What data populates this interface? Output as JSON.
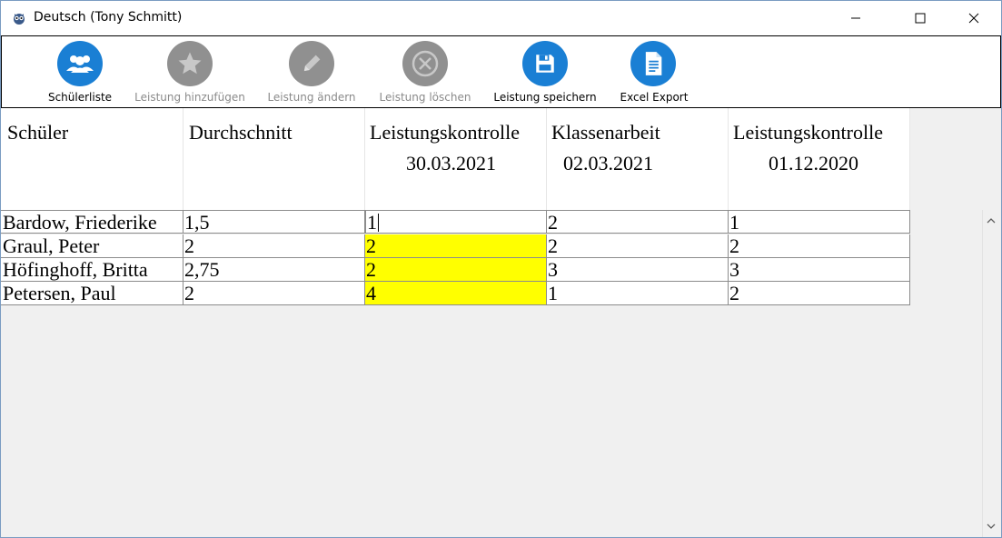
{
  "window": {
    "title": "Deutsch (Tony Schmitt)"
  },
  "toolbar": {
    "items": [
      {
        "label": "Schülerliste",
        "icon": "people-icon",
        "enabled": true
      },
      {
        "label": "Leistung hinzufügen",
        "icon": "star-icon",
        "enabled": false
      },
      {
        "label": "Leistung ändern",
        "icon": "pencil-icon",
        "enabled": false
      },
      {
        "label": "Leistung löschen",
        "icon": "delete-circle-icon",
        "enabled": false
      },
      {
        "label": "Leistung speichern",
        "icon": "floppy-disk-icon",
        "enabled": true
      },
      {
        "label": "Excel Export",
        "icon": "document-icon",
        "enabled": true
      }
    ]
  },
  "grid": {
    "headers": [
      {
        "line1": "Schüler",
        "line2": ""
      },
      {
        "line1": "Durchschnitt",
        "line2": ""
      },
      {
        "line1": "Leistungskontrolle",
        "line2": "30.03.2021"
      },
      {
        "line1": "Klassenarbeit",
        "line2": "02.03.2021"
      },
      {
        "line1": "Leistungskontrolle",
        "line2": "01.12.2020"
      }
    ],
    "rows": [
      {
        "name": "Bardow, Friederike",
        "avg": "1,5",
        "c1": "1",
        "c2": "2",
        "c3": "1"
      },
      {
        "name": "Graul, Peter",
        "avg": "2",
        "c1": "2",
        "c2": "2",
        "c3": "2"
      },
      {
        "name": "Höfinghoff, Britta",
        "avg": "2,75",
        "c1": "2",
        "c2": "3",
        "c3": "3"
      },
      {
        "name": "Petersen, Paul",
        "avg": "2",
        "c1": "4",
        "c2": "1",
        "c3": "2"
      }
    ]
  },
  "colors": {
    "accent": "#1a7fd4",
    "disabled": "#909090",
    "highlight": "#ffff00"
  }
}
